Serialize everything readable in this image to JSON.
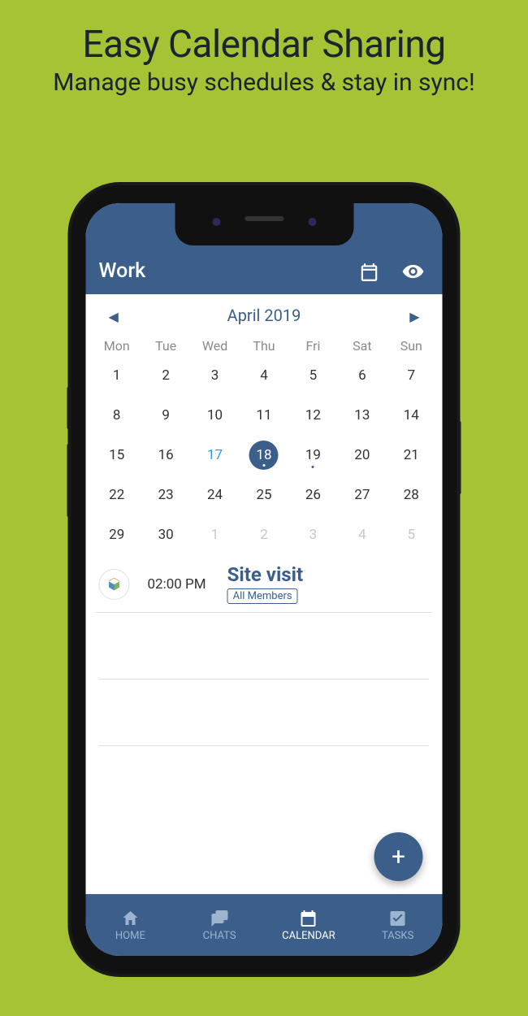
{
  "marketing": {
    "title": "Easy Calendar Sharing",
    "subtitle": "Manage busy schedules & stay in sync!"
  },
  "header": {
    "title": "Work"
  },
  "calendar": {
    "month_label": "April 2019",
    "weekdays": [
      "Mon",
      "Tue",
      "Wed",
      "Thu",
      "Fri",
      "Sat",
      "Sun"
    ],
    "days": [
      {
        "n": "1"
      },
      {
        "n": "2"
      },
      {
        "n": "3"
      },
      {
        "n": "4"
      },
      {
        "n": "5"
      },
      {
        "n": "6"
      },
      {
        "n": "7"
      },
      {
        "n": "8"
      },
      {
        "n": "9"
      },
      {
        "n": "10"
      },
      {
        "n": "11"
      },
      {
        "n": "12"
      },
      {
        "n": "13"
      },
      {
        "n": "14"
      },
      {
        "n": "15"
      },
      {
        "n": "16"
      },
      {
        "n": "17",
        "today": true
      },
      {
        "n": "18",
        "selected": true,
        "hasEvent": true
      },
      {
        "n": "19",
        "hasEvent": true
      },
      {
        "n": "20"
      },
      {
        "n": "21"
      },
      {
        "n": "22"
      },
      {
        "n": "23"
      },
      {
        "n": "24"
      },
      {
        "n": "25"
      },
      {
        "n": "26"
      },
      {
        "n": "27"
      },
      {
        "n": "28"
      },
      {
        "n": "29"
      },
      {
        "n": "30"
      },
      {
        "n": "1",
        "faded": true
      },
      {
        "n": "2",
        "faded": true
      },
      {
        "n": "3",
        "faded": true
      },
      {
        "n": "4",
        "faded": true
      },
      {
        "n": "5",
        "faded": true
      }
    ]
  },
  "events": [
    {
      "time": "02:00 PM",
      "title": "Site visit",
      "badge": "All Members"
    }
  ],
  "fab": {
    "label": "+"
  },
  "nav": {
    "items": [
      {
        "label": "HOME"
      },
      {
        "label": "CHATS"
      },
      {
        "label": "CALENDAR",
        "active": true
      },
      {
        "label": "TASKS"
      }
    ]
  }
}
